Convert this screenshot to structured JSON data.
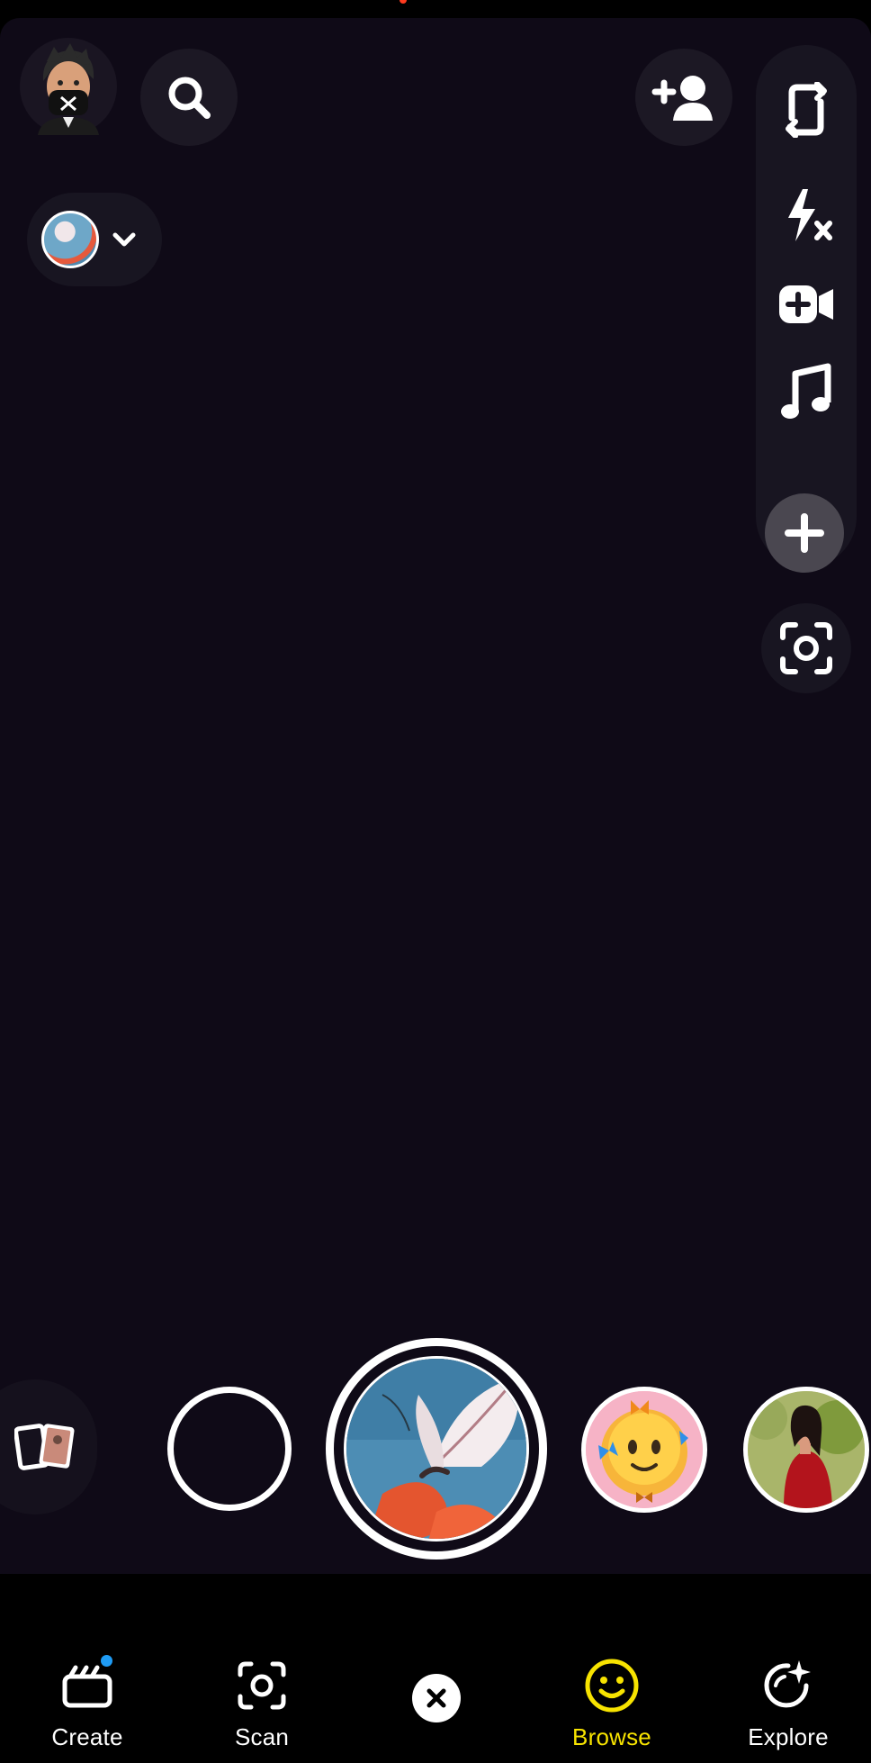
{
  "top_bar": {
    "profile_icon": "bitmoji-avatar-icon",
    "search_icon": "search-icon",
    "add_friend_icon": "add-friend-icon"
  },
  "lens_selector": {
    "thumbnail": "butterfly-lens-thumbnail",
    "chevron_icon": "chevron-down-icon"
  },
  "right_rail": {
    "items": [
      {
        "name": "flip-camera",
        "icon": "flip-camera-icon"
      },
      {
        "name": "flash-off",
        "icon": "flash-off-icon"
      },
      {
        "name": "video-chat",
        "icon": "video-plus-icon"
      },
      {
        "name": "music",
        "icon": "music-note-icon"
      },
      {
        "name": "more",
        "icon": "plus-icon"
      }
    ],
    "scan_icon": "scan-icon"
  },
  "carousel": {
    "memories_icon": "memories-cards-icon",
    "lenses": [
      {
        "name": "empty-lens-slot"
      },
      {
        "name": "butterfly-lens",
        "selected": true
      },
      {
        "name": "butterfly-emoji-lens"
      },
      {
        "name": "portrait-lens"
      }
    ]
  },
  "nav": {
    "items": [
      {
        "label": "Create",
        "icon": "create-icon",
        "active": false,
        "notification": true
      },
      {
        "label": "Scan",
        "icon": "scan-icon",
        "active": false
      },
      {
        "label": "Browse",
        "icon": "smiley-icon",
        "active": true
      },
      {
        "label": "Explore",
        "icon": "explore-sparkle-icon",
        "active": false
      }
    ],
    "close_icon": "close-icon"
  },
  "colors": {
    "camera_bg": "#0f0a17",
    "active_nav": "#f7e300",
    "notification_dot": "#1f9cf5",
    "recording_indicator": "#ff3b1f"
  }
}
